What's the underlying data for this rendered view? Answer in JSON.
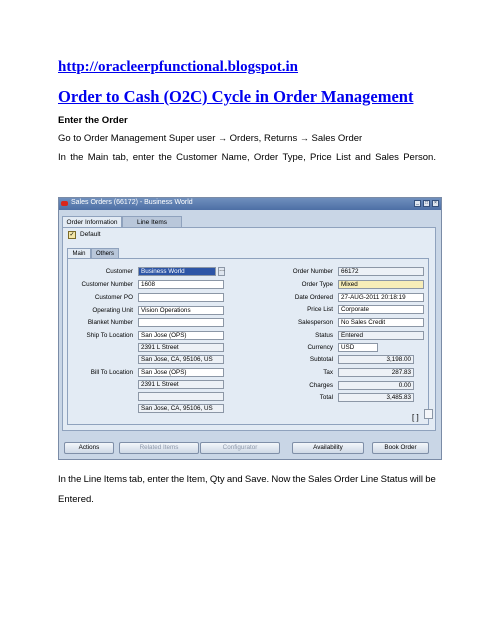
{
  "doc": {
    "url": "http://oracleerpfunctional.blogspot.in",
    "heading": "Order to Cash (O2C) Cycle in Order Management",
    "step_title": "Enter the Order",
    "nav_prefix": "Go to Order Management Super user",
    "nav_arrow": "→",
    "nav_orders": "Orders, Returns",
    "nav_sales": "Sales Order",
    "main_words": [
      "In",
      "the",
      "Main",
      "tab,",
      "enter",
      "the",
      "Customer",
      "Name,",
      "Order",
      "Type,",
      "Price",
      "List",
      "and",
      "Sales",
      "Person."
    ],
    "line_words": [
      "In",
      "the",
      "Line",
      "Items",
      "tab,",
      "enter",
      "the",
      "Item,",
      "Qty",
      "and",
      "Save.",
      "Now",
      "the",
      "Sales",
      "Order",
      "Line",
      "Status",
      "will",
      "be"
    ],
    "line_tail": "Entered."
  },
  "window": {
    "title": "Sales Orders (66172) - Business World",
    "tabs": [
      "Order Information",
      "Line Items"
    ],
    "default_label": "Default",
    "subtabs": [
      "Main",
      "Others"
    ],
    "left_labels": {
      "customer": "Customer",
      "customer_number": "Customer Number",
      "customer_po": "Customer PO",
      "operating_unit": "Operating Unit",
      "blanket_number": "Blanket Number",
      "ship_to": "Ship To Location",
      "bill_to": "Bill To Location"
    },
    "left_values": {
      "customer": "Business World",
      "customer_number": "1608",
      "customer_po": "",
      "operating_unit": "Vision Operations",
      "blanket_number": "",
      "ship_to_1": "San Jose (OPS)",
      "ship_to_2": "2391 L Street",
      "ship_to_3": "San Jose, CA, 95106, US",
      "bill_to_1": "San Jose (OPS)",
      "bill_to_2": "2391 L Street",
      "bill_to_3": "",
      "bill_to_4": "San Jose, CA, 95106, US"
    },
    "right_labels": {
      "order_number": "Order Number",
      "order_type": "Order Type",
      "date_ordered": "Date Ordered",
      "price_list": "Price List",
      "salesperson": "Salesperson",
      "status": "Status",
      "currency": "Currency",
      "subtotal": "Subtotal",
      "tax": "Tax",
      "charges": "Charges",
      "total": "Total"
    },
    "right_values": {
      "order_number": "66172",
      "order_type": "Mixed",
      "date_ordered": "27-AUG-2011 20:18:19",
      "price_list": "Corporate",
      "salesperson": "No Sales Credit",
      "status": "Entered",
      "currency": "USD",
      "subtotal": "3,198.00",
      "tax": "287.83",
      "charges": "0.00",
      "total": "3,485.83"
    },
    "bracket_text": "[ ]",
    "buttons": [
      "Actions",
      "Related Items",
      "Configurator",
      "Availability",
      "Book Order"
    ]
  },
  "colors": {
    "link": "#0000ee",
    "window_bg": "#c9d6e6",
    "titlebar": "#4d6fa5",
    "required_field": "#f7edb8"
  }
}
